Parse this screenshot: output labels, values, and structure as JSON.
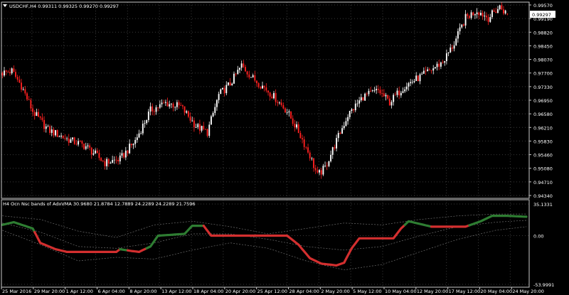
{
  "colors": {
    "background": "#000000",
    "grid": "#3a3a3a",
    "frame": "#c8c8c8",
    "text": "#ffffff",
    "bull_candle": "#ffffff",
    "bear_candle": "#ff2020",
    "price_label_bg": "#ffffff",
    "price_label_fg": "#000000",
    "band_line": "#6e6e6e",
    "indicator_up": "#2e7d32",
    "indicator_down": "#d32f2f"
  },
  "chart_data": [
    {
      "type": "candlestick",
      "header": "USDCHF,H4  0.99311 0.99325 0.99270 0.99297",
      "symbol": "USDCHF,H4",
      "ohlc_last": {
        "open": 0.99311,
        "high": 0.99325,
        "low": 0.9927,
        "close": 0.99297
      },
      "current_price_label": "0.99297",
      "y_ticks": [
        "0.99570",
        "0.99190",
        "0.98820",
        "0.98450",
        "0.98070",
        "0.97700",
        "0.97330",
        "0.96950",
        "0.96580",
        "0.96210",
        "0.95830",
        "0.95460",
        "0.95080",
        "0.94710",
        "0.94340"
      ],
      "ylim": [
        0.9434,
        0.9957
      ],
      "x_ticks": [
        "25 Mar 2016",
        "29 Mar 20:00",
        "1 Apr 12:00",
        "6 Apr 04:00",
        "8 Apr 20:00",
        "13 Apr 12:00",
        "18 Apr 04:00",
        "20 Apr 20:00",
        "25 Apr 12:00",
        "28 Apr 04:00",
        "2 May 20:00",
        "5 May 12:00",
        "10 May 04:00",
        "12 May 20:00",
        "17 May 12:00",
        "20 May 04:00",
        "24 May 20:00"
      ],
      "close_path": [
        {
          "i": 0,
          "v": 0.977
        },
        {
          "i": 5,
          "v": 0.9775
        },
        {
          "i": 10,
          "v": 0.9735
        },
        {
          "i": 16,
          "v": 0.9665
        },
        {
          "i": 24,
          "v": 0.9615
        },
        {
          "i": 34,
          "v": 0.959
        },
        {
          "i": 44,
          "v": 0.957
        },
        {
          "i": 54,
          "v": 0.9525
        },
        {
          "i": 62,
          "v": 0.9535
        },
        {
          "i": 70,
          "v": 0.9585
        },
        {
          "i": 78,
          "v": 0.9668
        },
        {
          "i": 86,
          "v": 0.9688
        },
        {
          "i": 94,
          "v": 0.9678
        },
        {
          "i": 102,
          "v": 0.9625
        },
        {
          "i": 108,
          "v": 0.9608
        },
        {
          "i": 114,
          "v": 0.971
        },
        {
          "i": 120,
          "v": 0.974
        },
        {
          "i": 126,
          "v": 0.979
        },
        {
          "i": 132,
          "v": 0.9755
        },
        {
          "i": 138,
          "v": 0.973
        },
        {
          "i": 144,
          "v": 0.97
        },
        {
          "i": 150,
          "v": 0.9665
        },
        {
          "i": 156,
          "v": 0.961
        },
        {
          "i": 162,
          "v": 0.9545
        },
        {
          "i": 166,
          "v": 0.949
        },
        {
          "i": 170,
          "v": 0.9512
        },
        {
          "i": 176,
          "v": 0.9585
        },
        {
          "i": 182,
          "v": 0.9655
        },
        {
          "i": 190,
          "v": 0.9705
        },
        {
          "i": 198,
          "v": 0.9722
        },
        {
          "i": 204,
          "v": 0.969
        },
        {
          "i": 212,
          "v": 0.9735
        },
        {
          "i": 222,
          "v": 0.9765
        },
        {
          "i": 232,
          "v": 0.98
        },
        {
          "i": 238,
          "v": 0.985
        },
        {
          "i": 244,
          "v": 0.992
        },
        {
          "i": 250,
          "v": 0.994
        },
        {
          "i": 256,
          "v": 0.992
        },
        {
          "i": 262,
          "v": 0.995
        },
        {
          "i": 266,
          "v": 0.99297
        }
      ]
    },
    {
      "type": "line",
      "title": "H4 Ocn Nsc bands of AdxVMA  30.9680 21.8784 12.7889 24.2289 24.2289 21.7596",
      "y_ticks": [
        "35.1331",
        "0.00",
        "-53.9991"
      ],
      "ylim": [
        -53.9991,
        35.1331
      ],
      "main_line": [
        {
          "i": 0,
          "v": 12.0
        },
        {
          "i": 6,
          "v": 15.0
        },
        {
          "i": 16,
          "v": 8.0
        },
        {
          "i": 20,
          "v": -8.0
        },
        {
          "i": 28,
          "v": -15.0
        },
        {
          "i": 34,
          "v": -18.0
        },
        {
          "i": 60,
          "v": -18.0
        },
        {
          "i": 62,
          "v": -15.0
        },
        {
          "i": 68,
          "v": -17.0
        },
        {
          "i": 72,
          "v": -18.0
        },
        {
          "i": 78,
          "v": -12.0
        },
        {
          "i": 82,
          "v": 0.0
        },
        {
          "i": 96,
          "v": 2.0
        },
        {
          "i": 100,
          "v": 11.0
        },
        {
          "i": 106,
          "v": 11.0
        },
        {
          "i": 110,
          "v": 0.0
        },
        {
          "i": 150,
          "v": 0.0
        },
        {
          "i": 156,
          "v": -10.0
        },
        {
          "i": 162,
          "v": -25.0
        },
        {
          "i": 168,
          "v": -31.0
        },
        {
          "i": 176,
          "v": -33.0
        },
        {
          "i": 180,
          "v": -30.0
        },
        {
          "i": 184,
          "v": -14.0
        },
        {
          "i": 188,
          "v": -3.0
        },
        {
          "i": 206,
          "v": -3.0
        },
        {
          "i": 210,
          "v": 8.0
        },
        {
          "i": 214,
          "v": 16.0
        },
        {
          "i": 226,
          "v": 10.0
        },
        {
          "i": 244,
          "v": 10.0
        },
        {
          "i": 252,
          "v": 16.0
        },
        {
          "i": 258,
          "v": 22.0
        },
        {
          "i": 266,
          "v": 22.0
        },
        {
          "i": 276,
          "v": 21.0
        }
      ],
      "up_segments": [
        [
          0,
          17
        ],
        [
          62,
          66
        ],
        [
          76,
          106
        ],
        [
          212,
          226
        ],
        [
          246,
          276
        ]
      ],
      "band_upper": [
        {
          "i": 0,
          "v": 22
        },
        {
          "i": 20,
          "v": 18
        },
        {
          "i": 40,
          "v": 5
        },
        {
          "i": 60,
          "v": -2
        },
        {
          "i": 80,
          "v": 12
        },
        {
          "i": 100,
          "v": 16
        },
        {
          "i": 120,
          "v": 10
        },
        {
          "i": 140,
          "v": 2
        },
        {
          "i": 160,
          "v": 8
        },
        {
          "i": 180,
          "v": 14
        },
        {
          "i": 200,
          "v": 12
        },
        {
          "i": 220,
          "v": 18
        },
        {
          "i": 240,
          "v": 22
        },
        {
          "i": 260,
          "v": 24
        },
        {
          "i": 276,
          "v": 24
        }
      ],
      "band_lower": [
        {
          "i": 0,
          "v": 6
        },
        {
          "i": 20,
          "v": -10
        },
        {
          "i": 40,
          "v": -28
        },
        {
          "i": 60,
          "v": -24
        },
        {
          "i": 80,
          "v": -26
        },
        {
          "i": 100,
          "v": -16
        },
        {
          "i": 120,
          "v": -8
        },
        {
          "i": 140,
          "v": -14
        },
        {
          "i": 160,
          "v": -28
        },
        {
          "i": 180,
          "v": -38
        },
        {
          "i": 200,
          "v": -32
        },
        {
          "i": 220,
          "v": -18
        },
        {
          "i": 240,
          "v": -4
        },
        {
          "i": 260,
          "v": 6
        },
        {
          "i": 276,
          "v": 10
        }
      ],
      "band_mid": [
        {
          "i": 0,
          "v": 14
        },
        {
          "i": 20,
          "v": 4
        },
        {
          "i": 40,
          "v": -12
        },
        {
          "i": 60,
          "v": -14
        },
        {
          "i": 80,
          "v": -8
        },
        {
          "i": 100,
          "v": 2
        },
        {
          "i": 120,
          "v": 2
        },
        {
          "i": 140,
          "v": -4
        },
        {
          "i": 160,
          "v": -12
        },
        {
          "i": 180,
          "v": -16
        },
        {
          "i": 200,
          "v": -12
        },
        {
          "i": 220,
          "v": 0
        },
        {
          "i": 240,
          "v": 10
        },
        {
          "i": 260,
          "v": 15
        },
        {
          "i": 276,
          "v": 17
        }
      ]
    }
  ]
}
